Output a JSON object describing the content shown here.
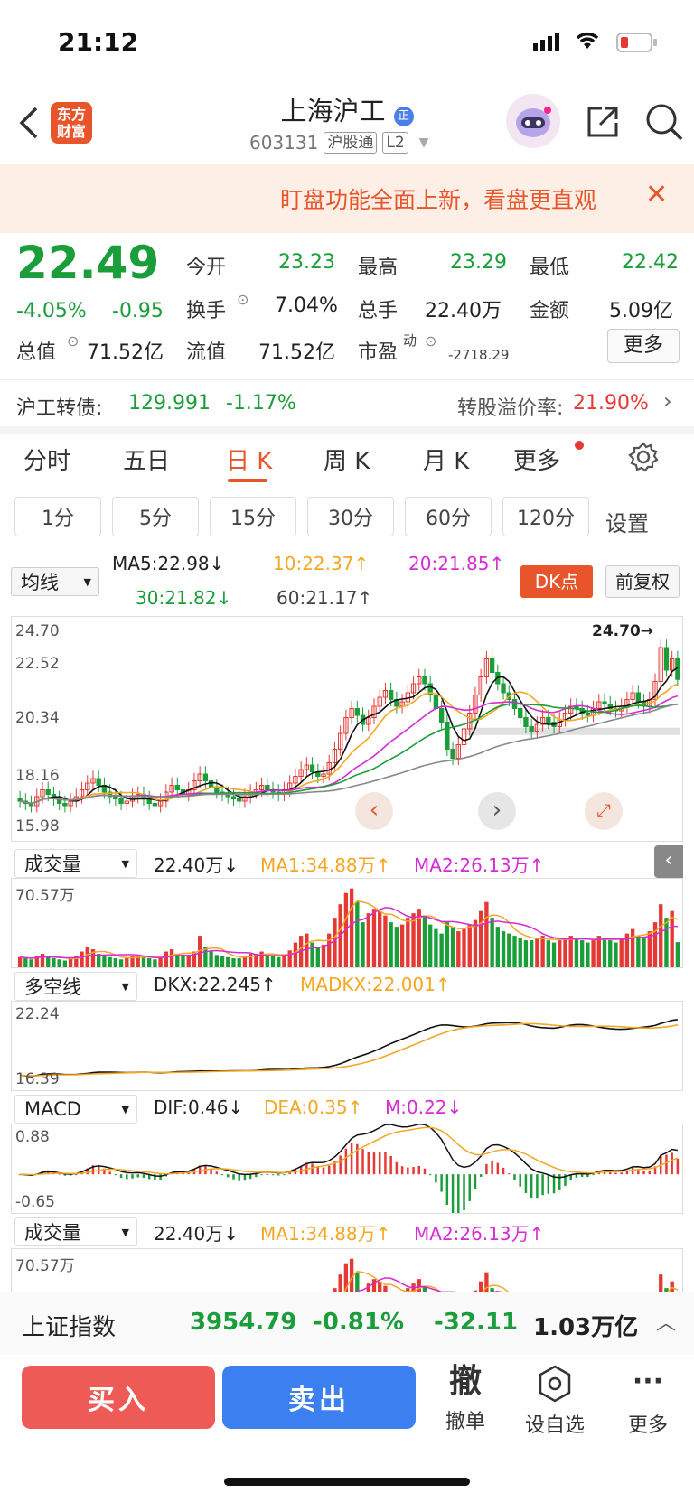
{
  "status": {
    "time": "21:12"
  },
  "header": {
    "stock_name": "上海沪工",
    "verified_badge": "正",
    "code": "603131",
    "tag1": "沪股通",
    "tag2": "L2",
    "logo_line1": "东方",
    "logo_line2": "财富"
  },
  "banner": {
    "text": "盯盘功能全面上新，看盘更直观"
  },
  "quote": {
    "price": "22.49",
    "pct": "-4.05%",
    "chg": "-0.95",
    "open_label": "今开",
    "open": "23.23",
    "high_label": "最高",
    "high": "23.29",
    "low_label": "最低",
    "low": "22.42",
    "turnover_label": "换手",
    "turnover": "7.04%",
    "volume_label": "总手",
    "volume": "22.40万",
    "amount_label": "金额",
    "amount": "5.09亿",
    "mktcap_label": "总值",
    "mktcap": "71.52亿",
    "float_label": "流值",
    "float": "71.52亿",
    "pe_label": "市盈",
    "pe_sup": "动",
    "pe": "-2718.29",
    "more": "更多"
  },
  "bond": {
    "label": "沪工转债:",
    "price": "129.991",
    "pct": "-1.17%",
    "premium_label": "转股溢价率:",
    "premium": "21.90%"
  },
  "tabs": [
    "分时",
    "五日",
    "日 K",
    "周 K",
    "月 K",
    "更多"
  ],
  "active_tab": "日 K",
  "timeframes": [
    "1分",
    "5分",
    "15分",
    "30分",
    "60分",
    "120分"
  ],
  "timeframe_settings": "设置",
  "ma": {
    "selector": "均线",
    "ma5": "MA5:22.98↓",
    "ma10": "10:22.37↑",
    "ma20": "20:21.85↑",
    "ma30": "30:21.82↓",
    "ma60": "60:21.17↑",
    "dk_button": "DK点",
    "adjust_button": "前复权"
  },
  "chart_data": [
    {
      "type": "candlestick",
      "title": "日K",
      "ylim": [
        15.98,
        24.7
      ],
      "y_ticks": [
        "24.70",
        "22.52",
        "20.34",
        "18.16",
        "15.98"
      ],
      "max_marker": "24.70→",
      "closes": [
        17.1,
        17.0,
        16.9,
        17.3,
        17.6,
        17.4,
        17.2,
        17.0,
        16.9,
        17.1,
        17.3,
        17.6,
        17.9,
        18.1,
        17.8,
        17.5,
        17.3,
        17.2,
        17.0,
        17.1,
        17.3,
        17.4,
        17.2,
        17.0,
        16.9,
        17.1,
        17.5,
        17.8,
        17.6,
        17.4,
        17.6,
        18.0,
        18.3,
        18.0,
        17.7,
        17.5,
        17.4,
        17.3,
        17.2,
        17.1,
        17.3,
        17.5,
        17.6,
        17.8,
        17.6,
        17.5,
        17.4,
        17.6,
        17.9,
        18.2,
        18.5,
        18.7,
        18.4,
        18.2,
        18.3,
        18.8,
        19.4,
        20.1,
        20.8,
        21.2,
        20.9,
        20.5,
        20.8,
        21.3,
        21.7,
        22.0,
        21.6,
        21.3,
        21.5,
        21.9,
        22.3,
        22.6,
        22.3,
        21.8,
        21.2,
        20.6,
        19.4,
        19.0,
        19.6,
        20.3,
        21.0,
        21.8,
        22.6,
        23.4,
        22.8,
        22.3,
        21.9,
        21.6,
        21.2,
        20.8,
        20.4,
        20.2,
        20.5,
        20.8,
        20.6,
        20.4,
        20.7,
        21.0,
        21.3,
        21.2,
        21.0,
        20.9,
        21.2,
        21.5,
        21.4,
        21.2,
        21.1,
        21.3,
        21.6,
        21.9,
        21.5,
        21.3,
        21.6,
        22.4,
        23.9,
        22.9,
        23.4,
        22.49
      ],
      "series": [
        {
          "name": "MA5",
          "value": 22.98
        },
        {
          "name": "MA10",
          "value": 22.37
        },
        {
          "name": "MA20",
          "value": 21.85
        },
        {
          "name": "MA30",
          "value": 21.82
        },
        {
          "name": "MA60",
          "value": 21.17
        }
      ]
    },
    {
      "type": "bar",
      "title": "成交量",
      "ylim": [
        0,
        70.57
      ],
      "y_ticks": [
        "70.57万"
      ],
      "values": [
        9,
        8,
        7,
        10,
        12,
        9,
        8,
        7,
        6,
        8,
        10,
        14,
        18,
        16,
        12,
        10,
        9,
        8,
        7,
        8,
        10,
        11,
        9,
        8,
        7,
        9,
        14,
        16,
        12,
        10,
        11,
        14,
        28,
        18,
        14,
        11,
        10,
        9,
        8,
        8,
        10,
        12,
        12,
        14,
        11,
        10,
        9,
        11,
        15,
        22,
        28,
        30,
        22,
        18,
        20,
        30,
        44,
        56,
        66,
        70,
        58,
        40,
        48,
        52,
        50,
        46,
        40,
        36,
        38,
        44,
        48,
        52,
        46,
        38,
        34,
        30,
        40,
        36,
        32,
        34,
        38,
        42,
        50,
        58,
        44,
        36,
        32,
        30,
        28,
        26,
        24,
        24,
        26,
        28,
        24,
        22,
        24,
        26,
        28,
        26,
        24,
        22,
        24,
        28,
        26,
        24,
        22,
        26,
        30,
        34,
        28,
        26,
        32,
        40,
        56,
        44,
        50,
        22.4
      ],
      "series": [
        {
          "name": "MA1",
          "value": 34.88
        },
        {
          "name": "MA2",
          "value": 26.13
        }
      ]
    },
    {
      "type": "line",
      "title": "多空线",
      "ylim": [
        16.39,
        22.24
      ],
      "y_ticks": [
        "22.24",
        "16.39"
      ],
      "series": [
        {
          "name": "DKX",
          "value": 22.245
        },
        {
          "name": "MADKX",
          "value": 22.001
        }
      ]
    },
    {
      "type": "bar",
      "title": "MACD",
      "ylim": [
        -0.65,
        0.88
      ],
      "y_ticks": [
        "0.88",
        "-0.65"
      ],
      "series": [
        {
          "name": "DIF",
          "value": 0.46
        },
        {
          "name": "DEA",
          "value": 0.35
        },
        {
          "name": "M",
          "value": 0.22
        }
      ]
    }
  ],
  "panels": {
    "vol_selector": "成交量",
    "vol_value": "22.40万↓",
    "vol_ma1": "MA1:34.88万↑",
    "vol_ma2": "MA2:26.13万↑",
    "vol_max": "70.57万",
    "dkx_selector": "多空线",
    "dkx": "DKX:22.245↑",
    "madkx": "MADKX:22.001↑",
    "dkx_max": "22.24",
    "dkx_min": "16.39",
    "macd_selector": "MACD",
    "dif": "DIF:0.46↓",
    "dea": "DEA:0.35↑",
    "m": "M:0.22↓",
    "macd_max": "0.88",
    "macd_min": "-0.65",
    "kline_max": "24.70",
    "kline_t2": "22.52",
    "kline_t3": "20.34",
    "kline_t4": "18.16",
    "kline_min": "15.98",
    "kline_marker": "24.70→"
  },
  "index_bar": {
    "name": "上证指数",
    "price": "3954.79",
    "pct": "-0.81%",
    "chg": "-32.11",
    "amount": "1.03万亿"
  },
  "actions": {
    "buy": "买入",
    "sell": "卖出",
    "cancel_glyph": "撤",
    "cancel_label": "撤单",
    "watch_label": "设自选",
    "more_label": "更多"
  },
  "colors": {
    "up": "#e53935",
    "down": "#1a9e3a",
    "accent": "#e85d1c",
    "buy": "#ee5a55",
    "sell": "#3b7ff0"
  }
}
